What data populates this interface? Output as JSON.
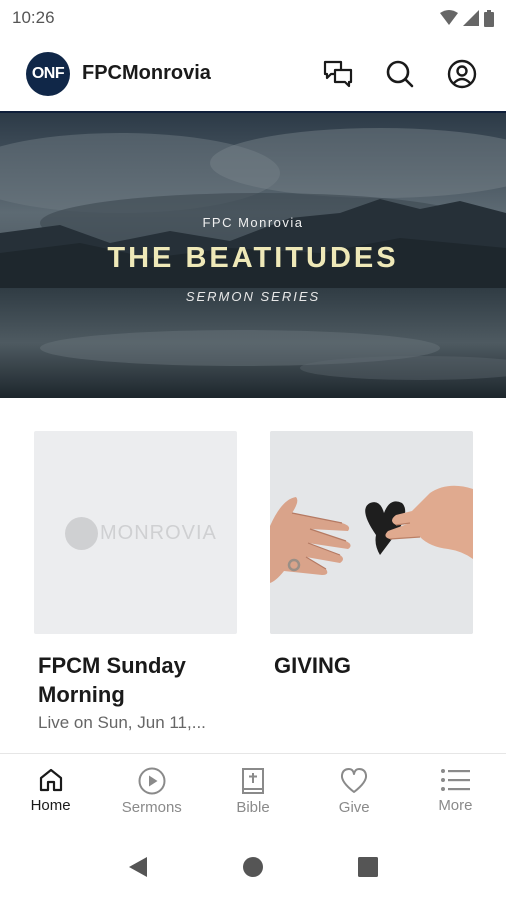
{
  "status_bar": {
    "time": "10:26"
  },
  "app_bar": {
    "logo_text": "ONF",
    "title": "FPCMonrovia",
    "actions": [
      "chat-icon",
      "search-icon",
      "account-icon"
    ]
  },
  "hero": {
    "org": "FPC Monrovia",
    "title": "THE BEATITUDES",
    "subtitle": "SERMON SERIES"
  },
  "cards": [
    {
      "title": "FPCM Sunday Morning",
      "meta": "Live on Sun, Jun 11,...",
      "thumb_text": "MONROVIA"
    },
    {
      "title": "GIVING",
      "meta": ""
    }
  ],
  "bottom_nav": [
    {
      "label": "Home",
      "icon": "home-icon",
      "active": true
    },
    {
      "label": "Sermons",
      "icon": "play-circle-icon",
      "active": false
    },
    {
      "label": "Bible",
      "icon": "bible-icon",
      "active": false
    },
    {
      "label": "Give",
      "icon": "heart-icon",
      "active": false
    },
    {
      "label": "More",
      "icon": "list-icon",
      "active": false
    }
  ],
  "colors": {
    "brand": "#102748",
    "hero_title": "#efe9b8"
  }
}
